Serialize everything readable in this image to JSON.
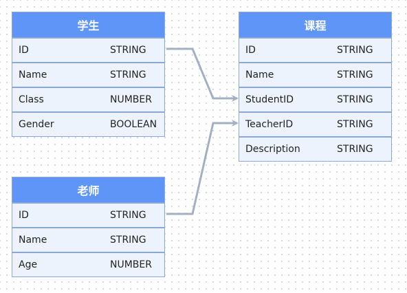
{
  "tables": {
    "student": {
      "title": "学生",
      "rows": [
        {
          "name": "ID",
          "type": "STRING"
        },
        {
          "name": "Name",
          "type": "STRING"
        },
        {
          "name": "Class",
          "type": "NUMBER"
        },
        {
          "name": "Gender",
          "type": "BOOLEAN"
        }
      ]
    },
    "course": {
      "title": "课程",
      "rows": [
        {
          "name": "ID",
          "type": "STRING"
        },
        {
          "name": "Name",
          "type": "STRING"
        },
        {
          "name": "StudentID",
          "type": "STRING"
        },
        {
          "name": "TeacherID",
          "type": "STRING"
        },
        {
          "name": "Description",
          "type": "STRING"
        }
      ]
    },
    "teacher": {
      "title": "老师",
      "rows": [
        {
          "name": "ID",
          "type": "STRING"
        },
        {
          "name": "Name",
          "type": "STRING"
        },
        {
          "name": "Age",
          "type": "NUMBER"
        }
      ]
    }
  },
  "colors": {
    "header": "#5f95f6",
    "connector": "#a3b0c2"
  }
}
